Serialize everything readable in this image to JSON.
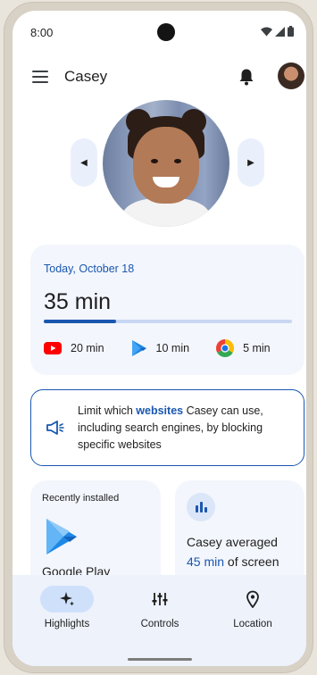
{
  "status_bar": {
    "time": "8:00"
  },
  "app_bar": {
    "title": "Casey"
  },
  "usage": {
    "date": "Today, October 18",
    "total": "35 min",
    "progress_fraction": 0.29,
    "apps": [
      {
        "icon": "youtube-icon",
        "time": "20 min"
      },
      {
        "icon": "google-play-icon",
        "time": "10 min"
      },
      {
        "icon": "chrome-icon",
        "time": "5 min"
      }
    ]
  },
  "websites_card": {
    "text_before": "Limit which ",
    "link": "websites",
    "text_after": " Casey can use, including search engines, by blocking specific websites",
    "icon": "megaphone-icon"
  },
  "recently_installed": {
    "header": "Recently installed",
    "app_name": "Google Play",
    "icon": "google-play-icon"
  },
  "average": {
    "line1": "Casey averaged",
    "value": "45 min",
    "line2_suffix": " of screen",
    "icon": "bar-chart-icon"
  },
  "bottom_nav": {
    "items": [
      {
        "label": "Highlights",
        "icon": "sparkle-icon",
        "active": true
      },
      {
        "label": "Controls",
        "icon": "sliders-icon",
        "active": false
      },
      {
        "label": "Location",
        "icon": "location-pin-icon",
        "active": false
      }
    ]
  },
  "colors": {
    "accent": "#1a57b0",
    "card_bg": "#f3f6fc",
    "nav_bg": "#edf2fb",
    "active_pill": "#cfe0fb"
  }
}
